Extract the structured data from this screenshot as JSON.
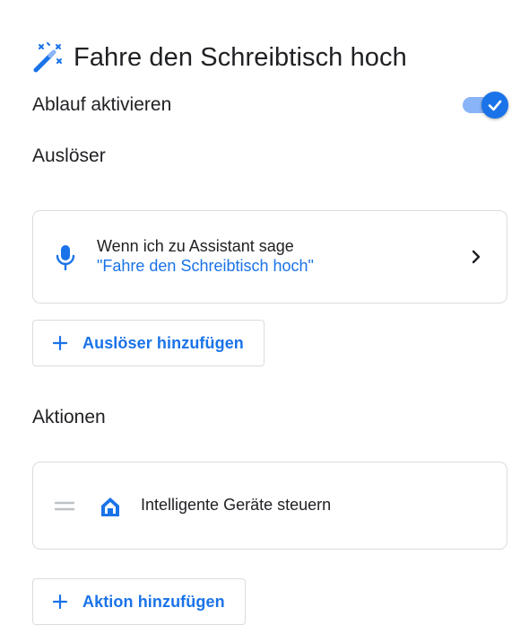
{
  "header": {
    "title": "Fahre den Schreibtisch hoch",
    "icon": "magic-wand-icon"
  },
  "activate": {
    "label": "Ablauf aktivieren",
    "enabled": true
  },
  "triggers": {
    "section_label": "Auslöser",
    "items": [
      {
        "icon": "microphone-icon",
        "title": "Wenn ich zu Assistant sage",
        "phrase": "\"Fahre den Schreibtisch hoch\""
      }
    ],
    "add_label": "Auslöser hinzufügen"
  },
  "actions": {
    "section_label": "Aktionen",
    "items": [
      {
        "icon": "home-icon",
        "label": "Intelligente Geräte steuern"
      }
    ],
    "add_label": "Aktion hinzufügen"
  },
  "colors": {
    "accent": "#1a73e8",
    "toggle_track": "#8ab4f8",
    "text": "#202124",
    "border": "#dadce0"
  }
}
